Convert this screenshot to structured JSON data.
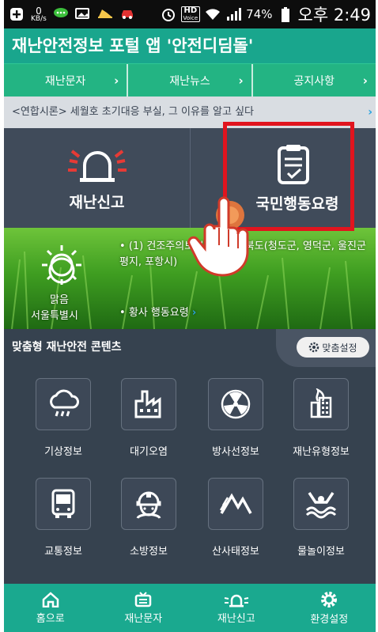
{
  "statusbar": {
    "speed_value": "0",
    "speed_unit": "KB/s",
    "hd_label": "HD",
    "voice_label": "Voice",
    "battery": "74%",
    "time": "오후 2:49",
    "icons": [
      "plus-icon",
      "chat-icon",
      "gallery-icon",
      "hat-icon",
      "car-icon",
      "alarm-icon",
      "wifi-icon",
      "signal-icon",
      "battery-icon"
    ]
  },
  "app": {
    "title": "재난안전정보 포털 앱 '안전디딤돌'"
  },
  "nav": {
    "tabs": [
      {
        "label": "재난문자"
      },
      {
        "label": "재난뉴스"
      },
      {
        "label": "공지사항"
      }
    ],
    "chevron": "›"
  },
  "ticker": {
    "text": "<연합시론> 세월호 초기대응 부실, 그 이유를 알고 싶다",
    "arrow": "›"
  },
  "actions": {
    "report_label": "재난신고",
    "guide_label": "국민행동요령"
  },
  "weather": {
    "condition": "맑음",
    "city": "서울특별시",
    "alert": "(1) 건조주의보 발표 : 경상북도(청도군, 영덕군, 울진군평지, 포항시)",
    "dust": "황사 행동요령",
    "bullet": "•"
  },
  "custom": {
    "title": "맞춤형 재난안전 콘텐츠",
    "setting_label": "맞춤설정",
    "items": [
      {
        "label": "기상정보",
        "icon": "weather-icon"
      },
      {
        "label": "대기오염",
        "icon": "factory-icon"
      },
      {
        "label": "방사선정보",
        "icon": "radiation-icon"
      },
      {
        "label": "재난유형정보",
        "icon": "fire-building-icon"
      },
      {
        "label": "교통정보",
        "icon": "bus-icon"
      },
      {
        "label": "소방정보",
        "icon": "firefighter-icon"
      },
      {
        "label": "산사태정보",
        "icon": "landslide-icon"
      },
      {
        "label": "물놀이정보",
        "icon": "swimming-icon"
      }
    ]
  },
  "bottomnav": {
    "items": [
      {
        "label": "홈으로",
        "icon": "home-icon"
      },
      {
        "label": "재난문자",
        "icon": "tv-icon"
      },
      {
        "label": "재난신고",
        "icon": "siren-icon"
      },
      {
        "label": "환경설정",
        "icon": "gear-icon"
      }
    ]
  },
  "colors": {
    "accent": "#19a68d",
    "nav_tab": "#23b483",
    "panel": "#36424f",
    "highlight": "#e1141e",
    "siren_red": "#e63a35",
    "link": "#27a3e0"
  }
}
